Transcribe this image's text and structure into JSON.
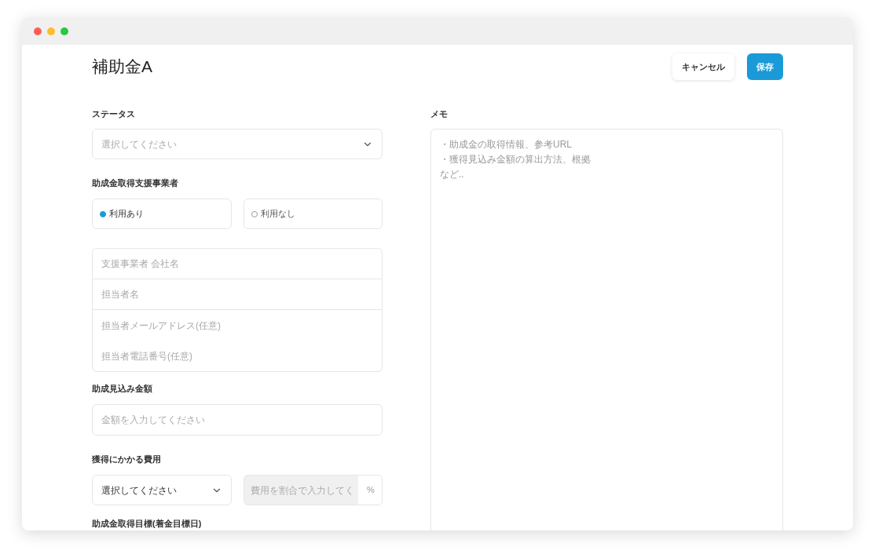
{
  "title": "補助金A",
  "buttons": [
    {
      "kind": "secondary",
      "label": "キャンセル"
    },
    {
      "kind": "primary",
      "label": "保存"
    }
  ],
  "status": {
    "label": "ステータス",
    "placeholder": "選択してください"
  },
  "support": {
    "label": "助成金取得支援事業者",
    "options": [
      {
        "label": "利用あり",
        "selected": true
      },
      {
        "label": "利用なし",
        "selected": false
      }
    ],
    "fields": [
      {
        "placeholder": "支援事業者 会社名"
      },
      {
        "placeholder": "担当者名"
      },
      {
        "placeholder": "担当者メールアドレス(任意)"
      },
      {
        "placeholder": "担当者電話番号(任意)"
      }
    ]
  },
  "amount": {
    "label": "助成見込み金額",
    "placeholder": "金額を入力してください"
  },
  "cost": {
    "label": "獲得にかかる費用",
    "select_value": "選択してください",
    "rate": {
      "placeholder": "費用を割合で入力してく",
      "disabled": true,
      "unit": "%"
    }
  },
  "target": {
    "label": "助成金取得目標(着金目標日)"
  },
  "memo": {
    "label": "メモ",
    "placeholder_lines": [
      "・助成金の取得情報、参考URL",
      "・獲得見込み金額の算出方法、根拠",
      "など.."
    ]
  }
}
